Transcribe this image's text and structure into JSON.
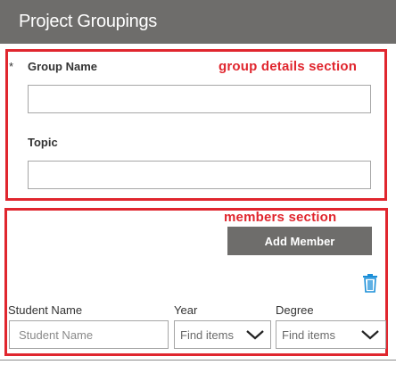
{
  "header": {
    "title": "Project Groupings"
  },
  "group_details": {
    "annotation": "group details section",
    "required_marker": "*",
    "group_name_label": "Group Name",
    "group_name_value": "",
    "topic_label": "Topic",
    "topic_value": ""
  },
  "members": {
    "annotation": "members section",
    "add_member_label": "Add Member",
    "columns": {
      "student_name": "Student Name",
      "year": "Year",
      "degree": "Degree"
    },
    "student_name_placeholder": "Student Name",
    "year_placeholder": "Find items",
    "degree_placeholder": "Find items"
  },
  "colors": {
    "header_bg": "#6e6d6b",
    "annotation_red": "#e0262e",
    "trash_blue": "#1b8fd8"
  },
  "icons": [
    "trash-icon",
    "chevron-down-icon"
  ]
}
